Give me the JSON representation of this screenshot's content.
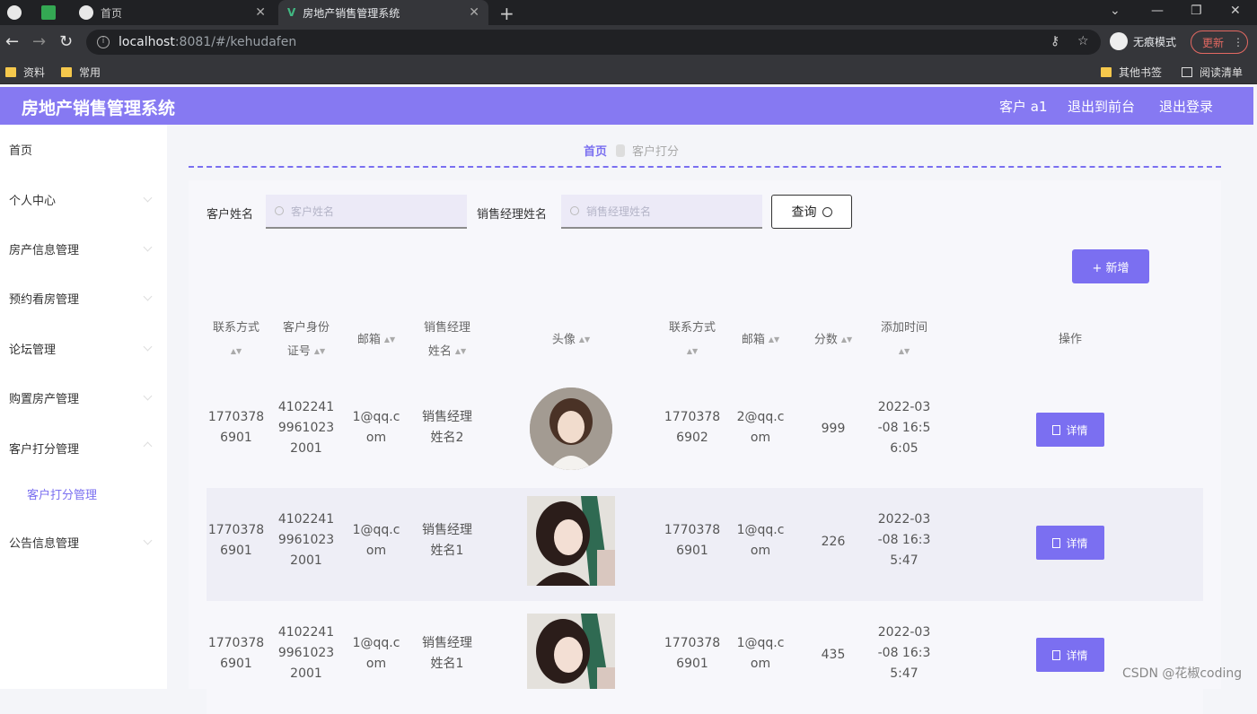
{
  "browser": {
    "tabs": [
      {
        "label": "首页"
      },
      {
        "label": "房地产销售管理系统"
      }
    ],
    "url_host": "localhost",
    "url_rest": ":8081/#/kehudafen",
    "incognito_label": "无痕模式",
    "update_label": "更新",
    "bookmarks": [
      {
        "label": "资料"
      },
      {
        "label": "常用"
      }
    ],
    "bookmarks_right": [
      {
        "label": "其他书签"
      },
      {
        "label": "阅读清单"
      }
    ]
  },
  "header": {
    "title": "房地产销售管理系统",
    "user_label": "客户 a1",
    "front_label": "退出到前台",
    "logout_label": "退出登录"
  },
  "sidebar": {
    "items": [
      {
        "label": "首页"
      },
      {
        "label": "个人中心"
      },
      {
        "label": "房产信息管理"
      },
      {
        "label": "预约看房管理"
      },
      {
        "label": "论坛管理"
      },
      {
        "label": "购置房产管理"
      },
      {
        "label": "客户打分管理"
      },
      {
        "label": "客户打分管理"
      },
      {
        "label": "公告信息管理"
      }
    ]
  },
  "breadcrumb": {
    "home": "首页",
    "current": "客户打分"
  },
  "search": {
    "customer_label": "客户姓名",
    "customer_placeholder": "客户姓名",
    "manager_label": "销售经理姓名",
    "manager_placeholder": "销售经理姓名",
    "query_label": "查询",
    "add_label": "+ 新增"
  },
  "table": {
    "headers": [
      "联系方式",
      "客户身份证号",
      "邮箱",
      "销售经理姓名",
      "头像",
      "联系方式",
      "邮箱",
      "分数",
      "添加时间",
      "操作"
    ],
    "header_lines": {
      "h0": [
        "联系方式"
      ],
      "h1": [
        "客户身份",
        "证号"
      ],
      "h2": [
        "邮箱"
      ],
      "h3": [
        "销售经理",
        "姓名"
      ],
      "h4": [
        "头像"
      ],
      "h5": [
        "联系方式"
      ],
      "h6": [
        "邮箱"
      ],
      "h7": [
        "分数"
      ],
      "h8": [
        "添加时间"
      ],
      "h9": [
        "操作"
      ]
    },
    "rows": [
      {
        "phone": [
          "1770378",
          "6901"
        ],
        "id_card": [
          "4102241",
          "9961023",
          "2001"
        ],
        "email": [
          "1@qq.c",
          "om"
        ],
        "manager": [
          "销售经理",
          "姓名2"
        ],
        "phone2": [
          "1770378",
          "6902"
        ],
        "email2": [
          "2@qq.c",
          "om"
        ],
        "score": "999",
        "time": [
          "2022-03",
          "-08 16:5",
          "6:05"
        ],
        "action": "详情"
      },
      {
        "phone": [
          "1770378",
          "6901"
        ],
        "id_card": [
          "4102241",
          "9961023",
          "2001"
        ],
        "email": [
          "1@qq.c",
          "om"
        ],
        "manager": [
          "销售经理",
          "姓名1"
        ],
        "phone2": [
          "1770378",
          "6901"
        ],
        "email2": [
          "1@qq.c",
          "om"
        ],
        "score": "226",
        "time": [
          "2022-03",
          "-08 16:3",
          "5:47"
        ],
        "action": "详情"
      },
      {
        "phone": [
          "1770378",
          "6901"
        ],
        "id_card": [
          "4102241",
          "9961023",
          "2001"
        ],
        "email": [
          "1@qq.c",
          "om"
        ],
        "manager": [
          "销售经理",
          "姓名1"
        ],
        "phone2": [
          "1770378",
          "6901"
        ],
        "email2": [
          "1@qq.c",
          "om"
        ],
        "score": "435",
        "time": [
          "2022-03",
          "-08 16:3",
          "5:47"
        ],
        "action": "详情"
      }
    ]
  },
  "watermark": "CSDN @花椒coding",
  "colors": {
    "accent": "#8679f2",
    "button": "#7b6ff1"
  }
}
